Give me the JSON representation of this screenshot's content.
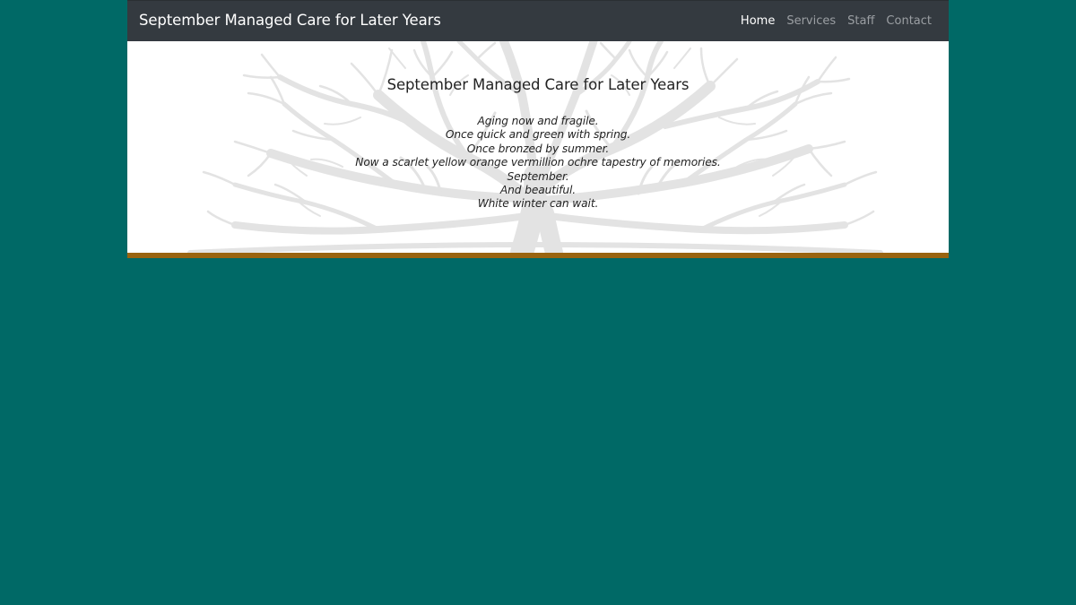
{
  "navbar": {
    "brand": "September Managed Care for Later Years",
    "links": [
      {
        "label": "Home",
        "active": true
      },
      {
        "label": "Services",
        "active": false
      },
      {
        "label": "Staff",
        "active": false
      },
      {
        "label": "Contact",
        "active": false
      }
    ]
  },
  "hero": {
    "title": "September Managed Care for Later Years",
    "poem": [
      "Aging now and fragile.",
      "Once quick and green with spring.",
      "Once bronzed by summer.",
      "Now a scarlet yellow orange vermillion ochre tapestry of memories.",
      "September.",
      "And beautiful.",
      "White winter can wait."
    ]
  },
  "colors": {
    "background": "#006966",
    "navbar": "#343a40",
    "accent": "#9a6410",
    "tree": "#e3e3e3"
  },
  "icons": {
    "hero_background": "bare-tree-silhouette"
  }
}
